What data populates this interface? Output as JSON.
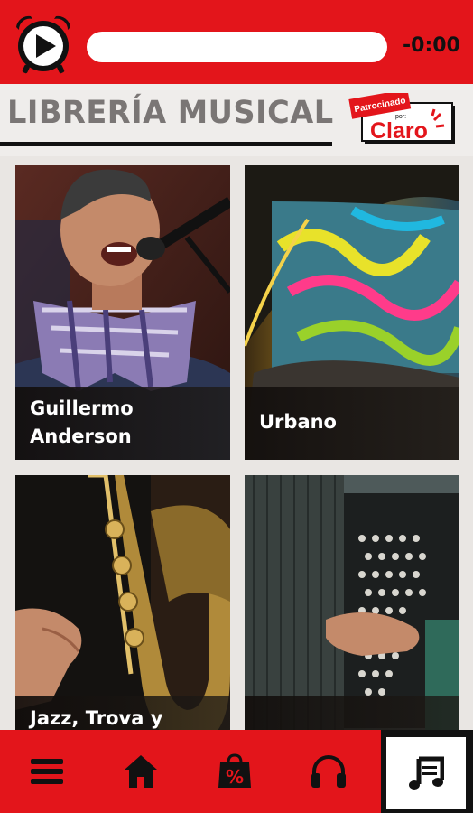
{
  "player": {
    "time": "-0:00"
  },
  "header": {
    "title": "LIBRERÍA MUSICAL",
    "sponsor_line1": "Patrocinado",
    "sponsor_line2": "por:",
    "sponsor_brand": "Claro"
  },
  "tiles": [
    {
      "lines": [
        "Guillermo",
        "Anderson"
      ]
    },
    {
      "lines": [
        "Urbano"
      ]
    },
    {
      "lines": [
        "Jazz, Trova y"
      ]
    },
    {
      "lines": []
    }
  ],
  "nav": {
    "items": [
      "menu-icon",
      "home-icon",
      "offers-icon",
      "headphones-icon",
      "music-library-icon"
    ],
    "active": "music-library-icon"
  },
  "colors": {
    "brand_red": "#e3151b",
    "title_gray": "#7a7675",
    "background": "#e9e6e3"
  }
}
